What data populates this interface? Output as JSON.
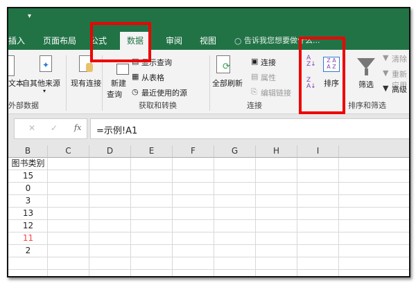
{
  "quick_access": {
    "customize_icon": "dropdown-arrow"
  },
  "tabs": [
    {
      "label": "插入"
    },
    {
      "label": "页面布局"
    },
    {
      "label": "公式"
    },
    {
      "label": "数据",
      "active": true
    },
    {
      "label": "审阅"
    },
    {
      "label": "视图"
    }
  ],
  "tell_me": "告诉我您想要做什么...",
  "ribbon": {
    "external": {
      "from_text": "文本",
      "other_sources": "自其他来源",
      "existing": "现有连接",
      "group": "外部数据"
    },
    "get_transform": {
      "new_query": "新建",
      "new_query2": "查询",
      "show_queries": "显示查询",
      "from_table": "从表格",
      "recent_sources": "最近使用的源",
      "group": "获取和转换"
    },
    "connections": {
      "refresh_all": "全部刷新",
      "connections": "连接",
      "properties": "属性",
      "edit_links": "编辑链接",
      "group": "连接"
    },
    "sort_filter": {
      "sort": "排序",
      "filter": "筛选",
      "clear": "清除",
      "reapply": "重新应用",
      "advanced": "高级",
      "group": "排序和筛选"
    }
  },
  "formula_bar": {
    "cancel": "✕",
    "enter": "✓",
    "fx": "fx",
    "formula": "=示例!A1"
  },
  "columns": [
    "B",
    "C",
    "D",
    "E",
    "F",
    "G",
    "H",
    "I"
  ],
  "cells_b": [
    {
      "v": "图书类别"
    },
    {
      "v": "15"
    },
    {
      "v": "0"
    },
    {
      "v": "3"
    },
    {
      "v": "13"
    },
    {
      "v": "12"
    },
    {
      "v": "11",
      "color": "#ff4040"
    },
    {
      "v": "2"
    },
    {
      "v": ""
    },
    {
      "v": ""
    }
  ],
  "highlight_color": "#ee0000",
  "theme_color": "#217346"
}
